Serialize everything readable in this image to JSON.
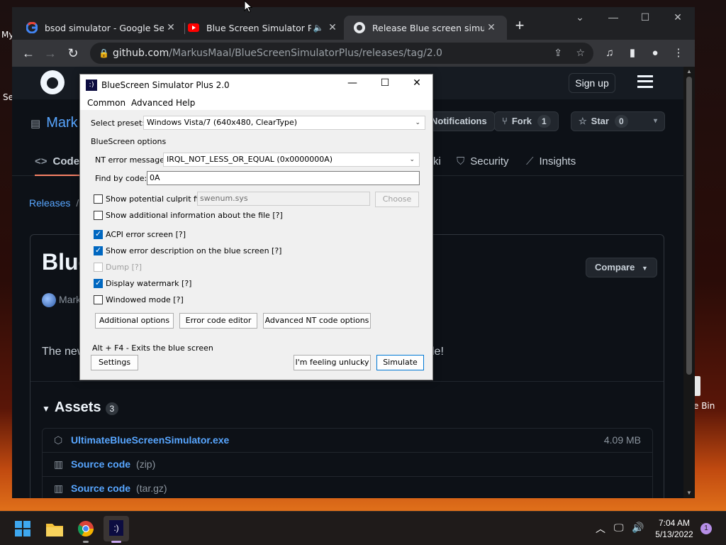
{
  "desktop": {
    "left_icon_fragments": [
      "My",
      "Se"
    ],
    "recycle_bin_fragment": "e Bin"
  },
  "browser": {
    "tabs": [
      {
        "title": "bsod simulator - Google Search",
        "icon": "google-icon"
      },
      {
        "title": "Blue Screen Simulator Plus",
        "icon": "youtube-icon"
      },
      {
        "title": "Release Blue screen simulator",
        "icon": "github-icon"
      }
    ],
    "new_tab": "+",
    "url_host": "github.com",
    "url_path": "/MarkusMaal/BlueScreenSimulatorPlus/releases/tag/2.0"
  },
  "github": {
    "signup": "Sign up",
    "repo_fragment": "Mark",
    "notifications": "Notifications",
    "fork_label": "Fork",
    "fork_count": "1",
    "star_label": "Star",
    "star_count": "0",
    "nav": {
      "code": "Code",
      "wiki_fragment": "ki",
      "security": "Security",
      "insights": "Insights"
    },
    "breadcrumb": "Releases",
    "release_title_fragment": "Blue",
    "compare": "Compare",
    "author_fragment": "Mark",
    "release_text_start": "The new",
    "release_text_end": "le!",
    "assets_title": "Assets",
    "assets_count": "3",
    "assets": [
      {
        "name": "UltimateBlueScreenSimulator.exe",
        "suffix": "",
        "size": "4.09 MB"
      },
      {
        "name": "Source code",
        "suffix": "(zip)",
        "size": ""
      },
      {
        "name": "Source code",
        "suffix": "(tar.gz)",
        "size": ""
      }
    ]
  },
  "dialog": {
    "title": "BlueScreen Simulator Plus 2.0",
    "menu": [
      "Common",
      "Advanced",
      "Help"
    ],
    "preset_label": "Select preset:",
    "preset_value": "Windows Vista/7 (640x480, ClearType)",
    "options_group": "BlueScreen options",
    "nt_error_label": "NT error message:",
    "nt_error_value": "IRQL_NOT_LESS_OR_EQUAL (0x0000000A)",
    "find_code_label": "Find by code:",
    "find_code_value": "0A",
    "culprit_label": "Show potential culprit file",
    "culprit_value": "swenum.sys",
    "choose_label": "Choose",
    "checkboxes": [
      {
        "label": "Show additional information about the file [?]",
        "checked": false
      },
      {
        "label": "ACPI error screen [?]",
        "checked": true
      },
      {
        "label": "Show error description on the blue screen [?]",
        "checked": true
      },
      {
        "label": "Dump [?]",
        "checked": false
      },
      {
        "label": "Display watermark [?]",
        "checked": true
      },
      {
        "label": "Windowed mode [?]",
        "checked": false
      }
    ],
    "buttons": [
      "Additional options",
      "Error code editor",
      "Advanced NT code options"
    ],
    "hint": "Alt + F4 - Exits the blue screen",
    "settings": "Settings",
    "unlucky": "I'm feeling unlucky",
    "simulate": "Simulate"
  },
  "taskbar": {
    "time": "7:04 AM",
    "date": "5/13/2022",
    "notification_count": "1"
  }
}
